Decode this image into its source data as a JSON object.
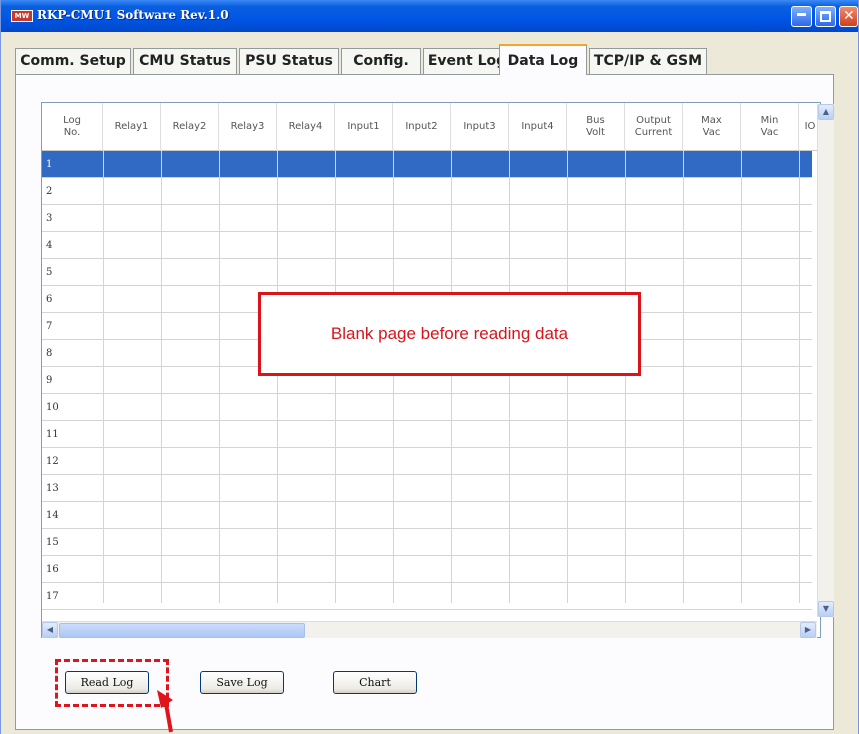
{
  "window": {
    "title": "RKP-CMU1 Software  Rev.1.0",
    "logo_text": "MW"
  },
  "tabs": [
    {
      "label": "Comm. Setup"
    },
    {
      "label": "CMU Status"
    },
    {
      "label": "PSU Status"
    },
    {
      "label": "Config."
    },
    {
      "label": "Event Log"
    },
    {
      "label": "Data Log",
      "active": true
    },
    {
      "label": "TCP/IP & GSM"
    }
  ],
  "grid": {
    "columns": [
      "Log\nNo.",
      "Relay1",
      "Relay2",
      "Relay3",
      "Relay4",
      "Input1",
      "Input2",
      "Input3",
      "Input4",
      "Bus\nVolt",
      "Output\nCurrent",
      "Max\nVac",
      "Min\nVac",
      "IO"
    ],
    "rows": [
      "1",
      "2",
      "3",
      "4",
      "5",
      "6",
      "7",
      "8",
      "9",
      "10",
      "11",
      "12",
      "13",
      "14",
      "15",
      "16",
      "17"
    ],
    "selected_row": "1"
  },
  "callout": {
    "text": "Blank page before reading data"
  },
  "buttons": {
    "read_log": "Read Log",
    "save_log": "Save Log",
    "chart": "Chart"
  },
  "colors": {
    "title_bar": "#0055e5",
    "selection": "#316ac5",
    "annotation_red": "#d9141b",
    "active_tab_accent": "#f7a32e"
  }
}
